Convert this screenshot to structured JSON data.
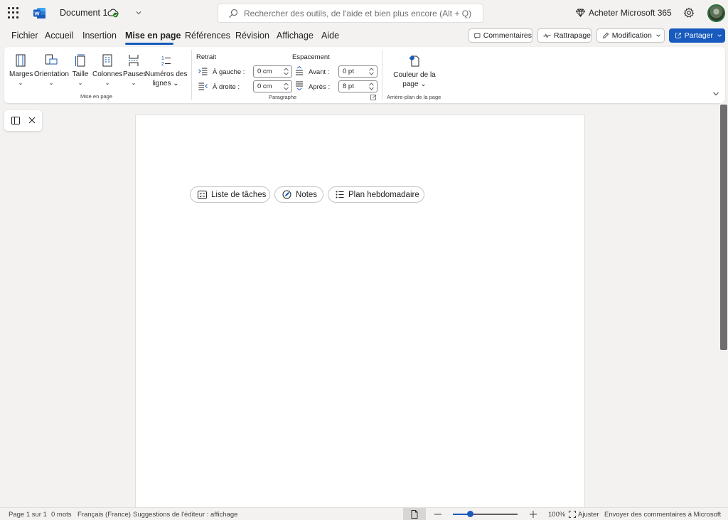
{
  "titlebar": {
    "doc_title": "Document 1",
    "search_placeholder": "Rechercher des outils, de l'aide et bien plus encore (Alt + Q)",
    "buy_label": "Acheter Microsoft 365",
    "brand_color": "#185abd"
  },
  "tabs": [
    "Fichier",
    "Accueil",
    "Insertion",
    "Mise en page",
    "Références",
    "Révision",
    "Affichage",
    "Aide"
  ],
  "active_tab": "Mise en page",
  "header_buttons": {
    "comments": "Commentaires",
    "catchup": "Rattrapage",
    "editing": "Modification",
    "share": "Partager"
  },
  "ribbon": {
    "page_setup": {
      "margins": "Marges",
      "orientation": "Orientation",
      "size": "Taille",
      "columns": "Colonnes",
      "breaks": "Pauses",
      "line_numbers_1": "Numéros des",
      "line_numbers_2": "lignes",
      "group_label": "Mise en page"
    },
    "paragraph": {
      "indent_title": "Retrait",
      "spacing_title": "Espacement",
      "left_label": "À gauche :",
      "left_value": "0 cm",
      "right_label": "À droite :",
      "right_value": "0 cm",
      "before_label": "Avant :",
      "before_value": "0 pt",
      "after_label": "Après :",
      "after_value": "8 pt",
      "group_label": "Paragraphe"
    },
    "background": {
      "page_color_1": "Couleur de la",
      "page_color_2": "page",
      "group_label": "Arrière-plan de la page"
    }
  },
  "suggestions": {
    "tasks": "Liste de tâches",
    "notes": "Notes",
    "weekly": "Plan hebdomadaire"
  },
  "statusbar": {
    "page": "Page 1 sur 1",
    "words": "0 mots",
    "language": "Français (France)",
    "editor": "Suggestions de l'éditeur : affichage",
    "zoom": "100%",
    "zoom_level": 0.26,
    "fit": "Ajuster",
    "feedback": "Envoyer des commentaires à Microsoft"
  }
}
